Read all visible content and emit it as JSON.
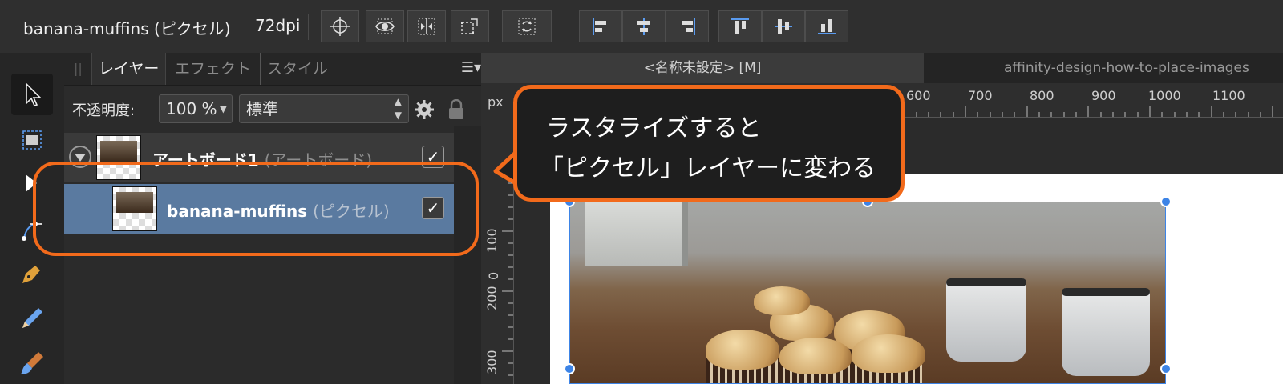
{
  "topbar": {
    "document_title": "banana-muffins (ピクセル)",
    "dpi": "72dpi",
    "tool_icons": [
      "target-icon",
      "view-eye-icon",
      "flip-horizontal-icon",
      "transform-icon",
      "sync-icon",
      "align-left-icon",
      "align-center-icon",
      "align-right-icon",
      "align-top-icon",
      "align-middle-icon",
      "align-bottom-icon"
    ]
  },
  "tools": [
    "move-tool-icon",
    "artboard-tool-icon",
    "node-tool-icon",
    "pen-tool-icon",
    "pencil-tool-icon",
    "brush-tool-icon"
  ],
  "layers_panel": {
    "tabs": [
      "レイヤー",
      "エフェクト",
      "スタイル"
    ],
    "opacity_label": "不透明度:",
    "opacity_value": "100 %",
    "blend_mode": "標準",
    "layers": [
      {
        "name": "アートボード1",
        "type": "(アートボード)"
      },
      {
        "name": "banana-muffins",
        "type": "(ピクセル)"
      }
    ]
  },
  "document_tabs": {
    "active": "<名称未設定> [M]",
    "other": "affinity-design-how-to-place-images"
  },
  "ruler": {
    "unit": "px",
    "h_ticks": [
      "600",
      "700",
      "800",
      "900",
      "1000",
      "1100"
    ],
    "v_ticks": [
      "0",
      "100",
      "200",
      "300"
    ]
  },
  "callout": {
    "line1": "ラスタライズすると",
    "line2": "「ピクセル」レイヤーに変わる"
  },
  "colors": {
    "highlight": "#f26a1b",
    "selection": "#3d84e6",
    "selected_row": "#5a7aa0"
  }
}
